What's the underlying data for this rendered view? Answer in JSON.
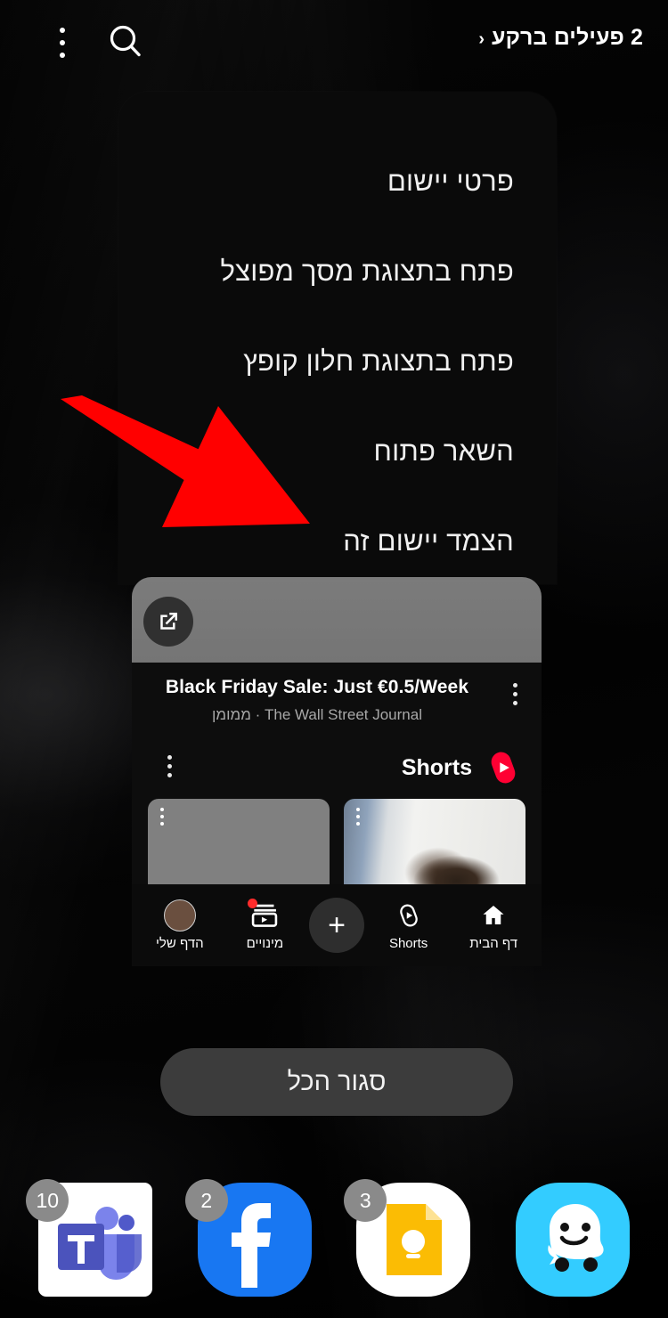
{
  "statusbar": {
    "background_apps_label": "2 פעילים ברקע",
    "chevron": "‹",
    "kebab_icon": "more-vert-icon",
    "search_icon": "search-icon"
  },
  "popup_menu": {
    "items": [
      {
        "label": "פרטי יישום",
        "name": "app-info"
      },
      {
        "label": "פתח בתצוגת מסך מפוצל",
        "name": "open-split-screen"
      },
      {
        "label": "פתח בתצוגת חלון קופץ",
        "name": "open-popup-window"
      },
      {
        "label": "השאר פתוח",
        "name": "keep-open"
      },
      {
        "label": "הצמד יישום זה",
        "name": "pin-this-app"
      }
    ]
  },
  "app_card": {
    "external_link_icon": "external-link-icon",
    "ad": {
      "title": "Black Friday Sale: Just €0.5/Week",
      "subtitle": "The Wall Street Journal · ממומן",
      "kebab_icon": "more-vert-icon"
    },
    "shorts": {
      "title": "Shorts",
      "logo_icon": "youtube-shorts-icon",
      "kebab_icon": "more-vert-icon",
      "thumbnails": [
        {
          "name": "shorts-thumbnail-person",
          "kebab_icon": "more-vert-icon"
        },
        {
          "name": "shorts-thumbnail-placeholder",
          "kebab_icon": "more-vert-icon"
        }
      ]
    },
    "bottom_nav": [
      {
        "label": "דף הבית",
        "icon": "home-icon",
        "name": "nav-home"
      },
      {
        "label": "Shorts",
        "icon": "shorts-icon",
        "name": "nav-shorts"
      },
      {
        "label": "",
        "icon": "plus-icon",
        "name": "nav-create"
      },
      {
        "label": "מינויים",
        "icon": "subscriptions-icon",
        "name": "nav-subscriptions",
        "has_badge": true
      },
      {
        "label": "הדף שלי",
        "icon": "avatar-icon",
        "name": "nav-you"
      }
    ]
  },
  "close_all": {
    "label": "סגור הכל"
  },
  "dock": {
    "apps": [
      {
        "name": "waze",
        "label": "Waze",
        "badge": "",
        "color": "#33ccff"
      },
      {
        "name": "google-keep",
        "label": "Keep",
        "badge": "3",
        "color": "#fbbc04"
      },
      {
        "name": "facebook",
        "label": "Facebook",
        "badge": "2",
        "color": "#1877f2"
      },
      {
        "name": "microsoft-teams",
        "label": "Microsoft Teams",
        "badge": "10",
        "color": "#5b5fc7"
      }
    ]
  },
  "annotation": {
    "arrow_color": "#ff0000",
    "arrow_name": "red-pointer-arrow"
  }
}
